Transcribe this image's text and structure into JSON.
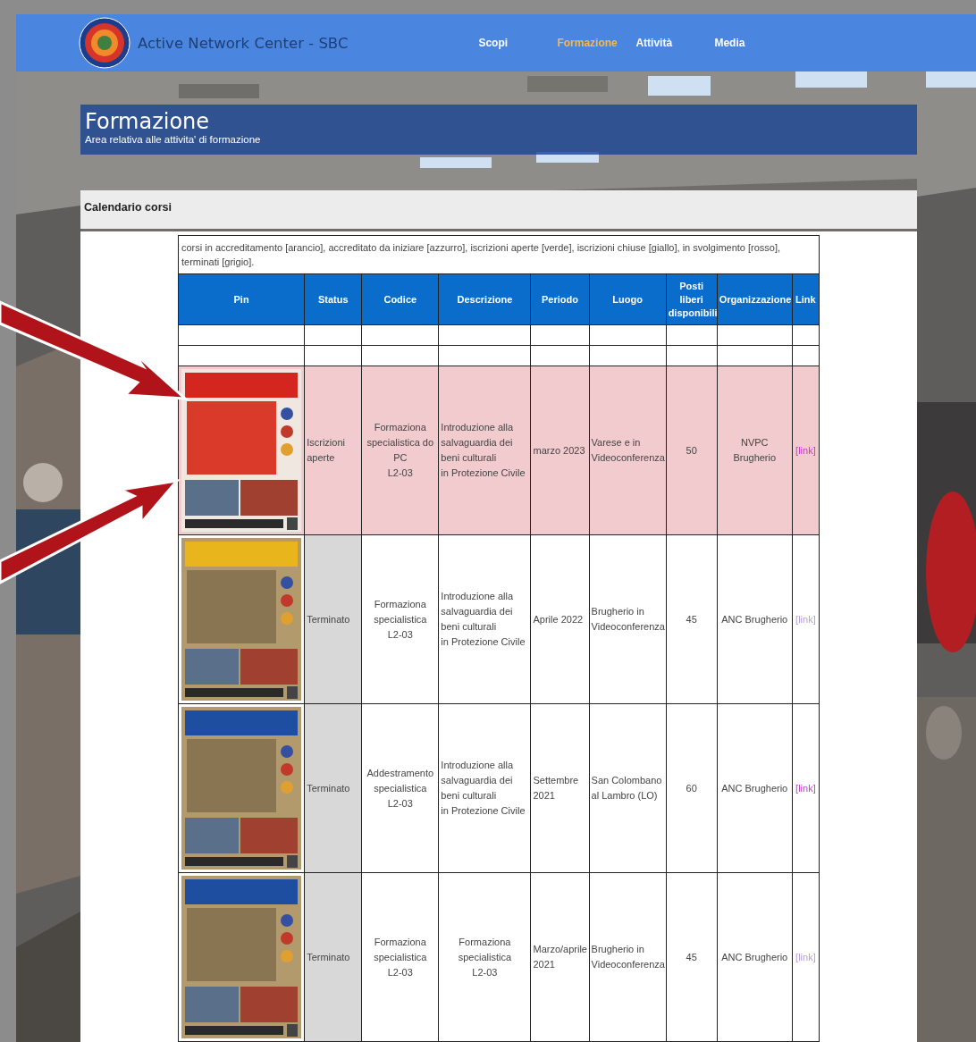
{
  "header": {
    "site_title": "Active Network Center - SBC",
    "nav": [
      {
        "label": "Scopi",
        "selected": false
      },
      {
        "label": "Formazione",
        "selected": true
      },
      {
        "label": "Attività",
        "selected": false
      },
      {
        "label": "Media",
        "selected": false
      }
    ]
  },
  "page_title": "Formazione",
  "page_subtitle": "Area relativa alle attivita' di formazione",
  "section": {
    "title": "Calendario corsi"
  },
  "table": {
    "legend": "corsi in accreditamento [arancio], accreditato da iniziare [azzurro], iscrizioni aperte [verde], iscrizioni chiuse [giallo], in svolgimento [rosso], terminati [grigio].",
    "columns": [
      "Pin",
      "Status",
      "Codice",
      "Descrizione",
      "Periodo",
      "Luogo",
      "Posti\nliberi\ndisponibili",
      "Organizzazione",
      "Link"
    ],
    "rows": [
      {
        "kind": "blank"
      },
      {
        "kind": "blank"
      },
      {
        "kind": "highlighted",
        "color": "#f2cbce",
        "status": "Iscrizioni\naperte",
        "code": "Formaziona\nspecialistica do\nPC\nL2-03",
        "description": "Introduzione alla\nsalvaguardia dei\nbeni culturali\nin Protezione Civile",
        "description_centered": false,
        "period": "marzo 2023",
        "place": "Varese e in\nVideoconferenza",
        "seats": "50",
        "organization": "NVPC Brugherio",
        "link": "[link]",
        "visited": false
      },
      {
        "kind": "plain",
        "color": "#d8d8d8",
        "status": "Terminato",
        "code": "Formaziona\nspecialistica\nL2-03",
        "description": "Introduzione alla\nsalvaguardia dei\nbeni culturali\nin Protezione Civile",
        "description_centered": false,
        "period": "Aprile 2022",
        "place": "Brugherio in\nVideoconferenza",
        "seats": "45",
        "organization": "ANC Brugherio",
        "link": "[link]",
        "visited": true
      },
      {
        "kind": "plain",
        "color": "#d8d8d8",
        "status": "Terminato",
        "code": "Addestramento\nspecialistica\nL2-03",
        "description": "Introduzione alla\nsalvaguardia dei\nbeni culturali\nin Protezione Civile",
        "description_centered": false,
        "period": "Settembre\n2021",
        "place": "San Colombano\nal Lambro (LO)",
        "seats": "60",
        "organization": "ANC Brugherio",
        "link": "[link]",
        "visited": false
      },
      {
        "kind": "plain",
        "color": "#d8d8d8",
        "status": "Terminato",
        "code": "Formaziona\nspecialistica\nL2-03",
        "description": "Formaziona\nspecialistica\nL2-03",
        "description_centered": true,
        "period": "Marzo/aprile\n2021",
        "place": "Brugherio in\nVideoconferenza",
        "seats": "45",
        "organization": "ANC Brugherio",
        "link": "[link]",
        "visited": true
      }
    ]
  }
}
